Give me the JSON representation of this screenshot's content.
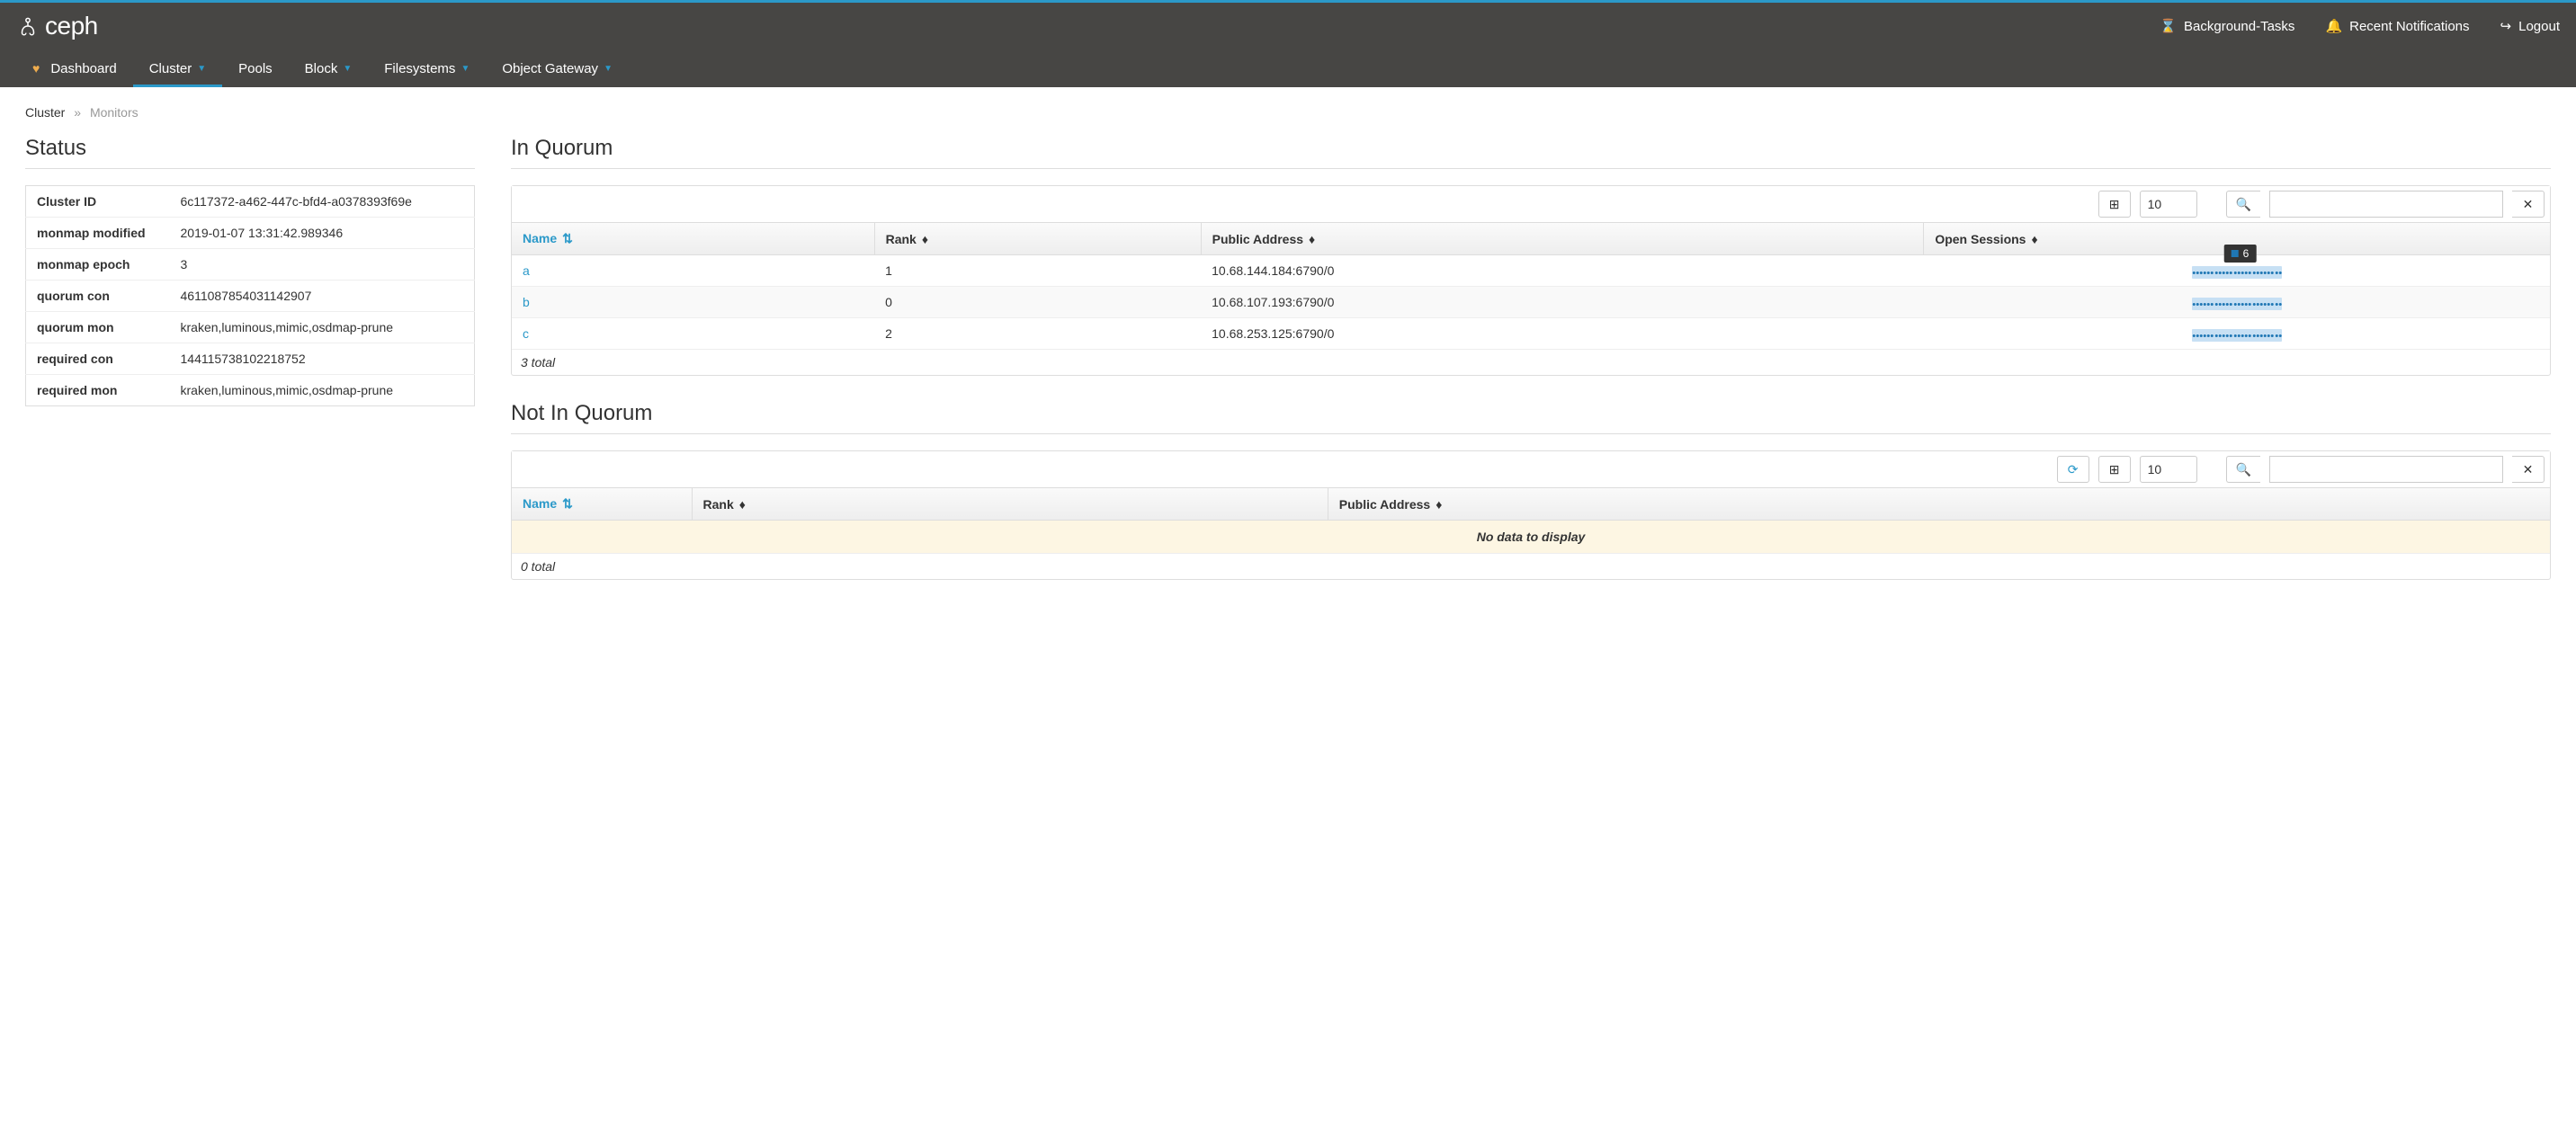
{
  "brand": "ceph",
  "top_links": {
    "tasks": "Background-Tasks",
    "notifications": "Recent Notifications",
    "logout": "Logout"
  },
  "nav": {
    "dashboard": "Dashboard",
    "cluster": "Cluster",
    "pools": "Pools",
    "block": "Block",
    "filesystems": "Filesystems",
    "object_gateway": "Object Gateway"
  },
  "breadcrumb": {
    "root": "Cluster",
    "current": "Monitors"
  },
  "status": {
    "title": "Status",
    "rows": [
      {
        "label": "Cluster ID",
        "value": "6c117372-a462-447c-bfd4-a0378393f69e"
      },
      {
        "label": "monmap modified",
        "value": "2019-01-07 13:31:42.989346"
      },
      {
        "label": "monmap epoch",
        "value": "3"
      },
      {
        "label": "quorum con",
        "value": "4611087854031142907"
      },
      {
        "label": "quorum mon",
        "value": "kraken,luminous,mimic,osdmap-prune"
      },
      {
        "label": "required con",
        "value": "144115738102218752"
      },
      {
        "label": "required mon",
        "value": "kraken,luminous,mimic,osdmap-prune"
      }
    ]
  },
  "in_quorum": {
    "title": "In Quorum",
    "page_size": "10",
    "columns": {
      "name": "Name",
      "rank": "Rank",
      "addr": "Public Address",
      "sessions": "Open Sessions"
    },
    "tooltip_value": "6",
    "rows": [
      {
        "name": "a",
        "rank": "1",
        "addr": "10.68.144.184:6790/0"
      },
      {
        "name": "b",
        "rank": "0",
        "addr": "10.68.107.193:6790/0"
      },
      {
        "name": "c",
        "rank": "2",
        "addr": "10.68.253.125:6790/0"
      }
    ],
    "footer": "3 total"
  },
  "not_in_quorum": {
    "title": "Not In Quorum",
    "page_size": "10",
    "columns": {
      "name": "Name",
      "rank": "Rank",
      "addr": "Public Address"
    },
    "no_data": "No data to display",
    "footer": "0 total"
  },
  "chart_data": {
    "type": "line",
    "title": "Open Sessions sparklines per monitor",
    "series": [
      {
        "name": "a",
        "values": [
          6,
          6,
          6,
          6,
          6,
          6,
          6,
          6,
          6,
          6,
          6,
          6,
          6,
          6,
          6,
          6,
          6,
          6,
          6,
          6,
          6,
          6,
          6,
          6
        ]
      },
      {
        "name": "b",
        "values": [
          6,
          6,
          6,
          6,
          6,
          6,
          6,
          6,
          6,
          6,
          6,
          6,
          6,
          6,
          6,
          6,
          6,
          6,
          6,
          6,
          6,
          6,
          6,
          6
        ]
      },
      {
        "name": "c",
        "values": [
          6,
          6,
          6,
          6,
          6,
          6,
          6,
          6,
          6,
          6,
          6,
          6,
          6,
          6,
          6,
          6,
          6,
          6,
          6,
          6,
          6,
          6,
          6,
          6
        ]
      }
    ],
    "ylabel": "sessions",
    "ylim": [
      0,
      10
    ]
  }
}
